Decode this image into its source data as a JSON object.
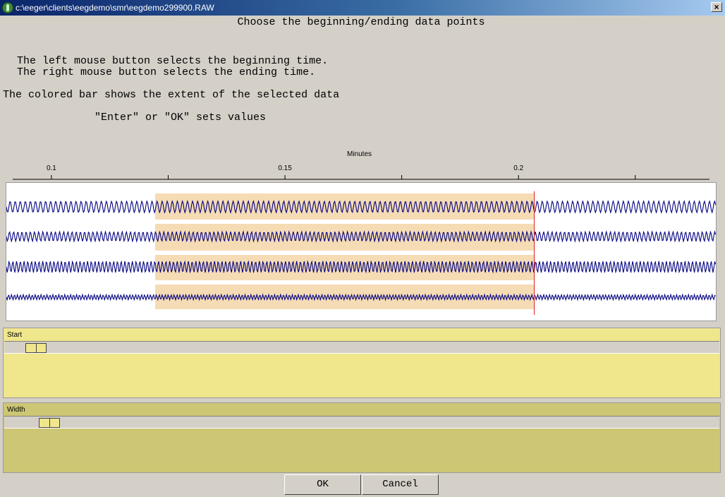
{
  "window": {
    "title": "c:\\eeger\\clients\\eegdemo\\smr\\eegdemo299900.RAW",
    "close_glyph": "×"
  },
  "instructions": {
    "heading": "Choose the beginning/ending data points",
    "line1": "The left mouse button selects the beginning time.",
    "line2": "The right mouse button selects the ending time.",
    "line3": "The colored bar shows the extent of the selected data",
    "line4": "\"Enter\" or \"OK\" sets values"
  },
  "chart_data": {
    "type": "line",
    "xlabel": "Minutes",
    "tick_labels": [
      "0.1",
      "0.15",
      "0.2"
    ],
    "tick_values": [
      0.1,
      0.15,
      0.2
    ],
    "xlim": [
      0.0902,
      0.2424
    ],
    "selection": {
      "start": 0.1221,
      "end": 0.2032
    },
    "selection_color": "#f5dcb5",
    "marker_color": "#e02020",
    "series": [
      {
        "amplitude": 1.0,
        "cycles": 140
      },
      {
        "amplitude": 0.85,
        "cycles": 170
      },
      {
        "amplitude": 1.0,
        "cycles": 190
      },
      {
        "amplitude": 0.45,
        "cycles": 240
      }
    ],
    "line_color": "#000080"
  },
  "panels": {
    "start": {
      "label": "Start",
      "position": 0.03
    },
    "width": {
      "label": "Width",
      "position": 0.05
    }
  },
  "buttons": {
    "ok": "OK",
    "cancel": "Cancel"
  }
}
